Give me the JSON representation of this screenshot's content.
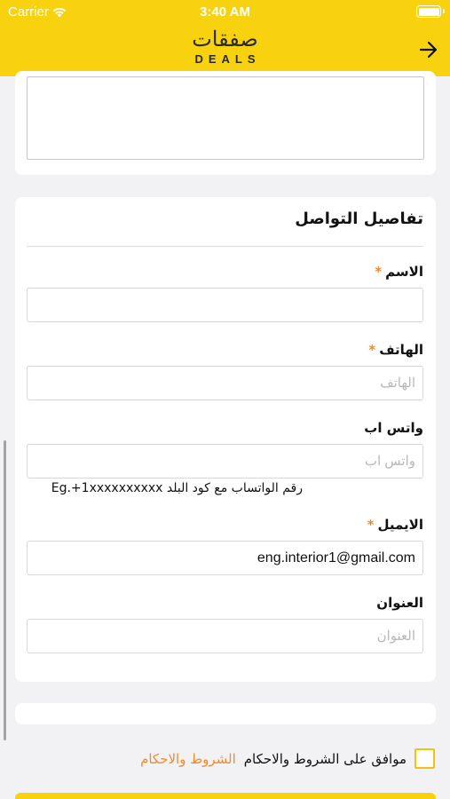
{
  "status_bar": {
    "carrier": "Carrier",
    "time": "3:40 AM"
  },
  "header": {
    "logo_arabic": "صفقات",
    "logo_english": "DEALS",
    "back_icon": "arrow-right-icon",
    "background_color": "#f9d20f"
  },
  "contact": {
    "title": "تفاصيل التواصل",
    "required_mark": "*",
    "name": {
      "label": "الاسم",
      "value": "",
      "placeholder": ""
    },
    "phone": {
      "label": "الهاتف",
      "value": "",
      "placeholder": "الهاتف"
    },
    "whatsapp": {
      "label": "واتس اب",
      "value": "",
      "placeholder": "واتس اب",
      "hint": "رقم الواتساب مع كود البلد Eg.+1xxxxxxxxxx"
    },
    "email": {
      "label": "الايميل",
      "value": "eng.interior1@gmail.com",
      "placeholder": ""
    },
    "address": {
      "label": "العنوان",
      "value": "",
      "placeholder": "العنوان"
    }
  },
  "agreement": {
    "checked": false,
    "text": "موافق على الشروط والاحكام",
    "link": "الشروط والاحكام"
  },
  "colors": {
    "accent": "#f9d20f",
    "required": "#f28a2e",
    "link": "#f28a2e"
  }
}
